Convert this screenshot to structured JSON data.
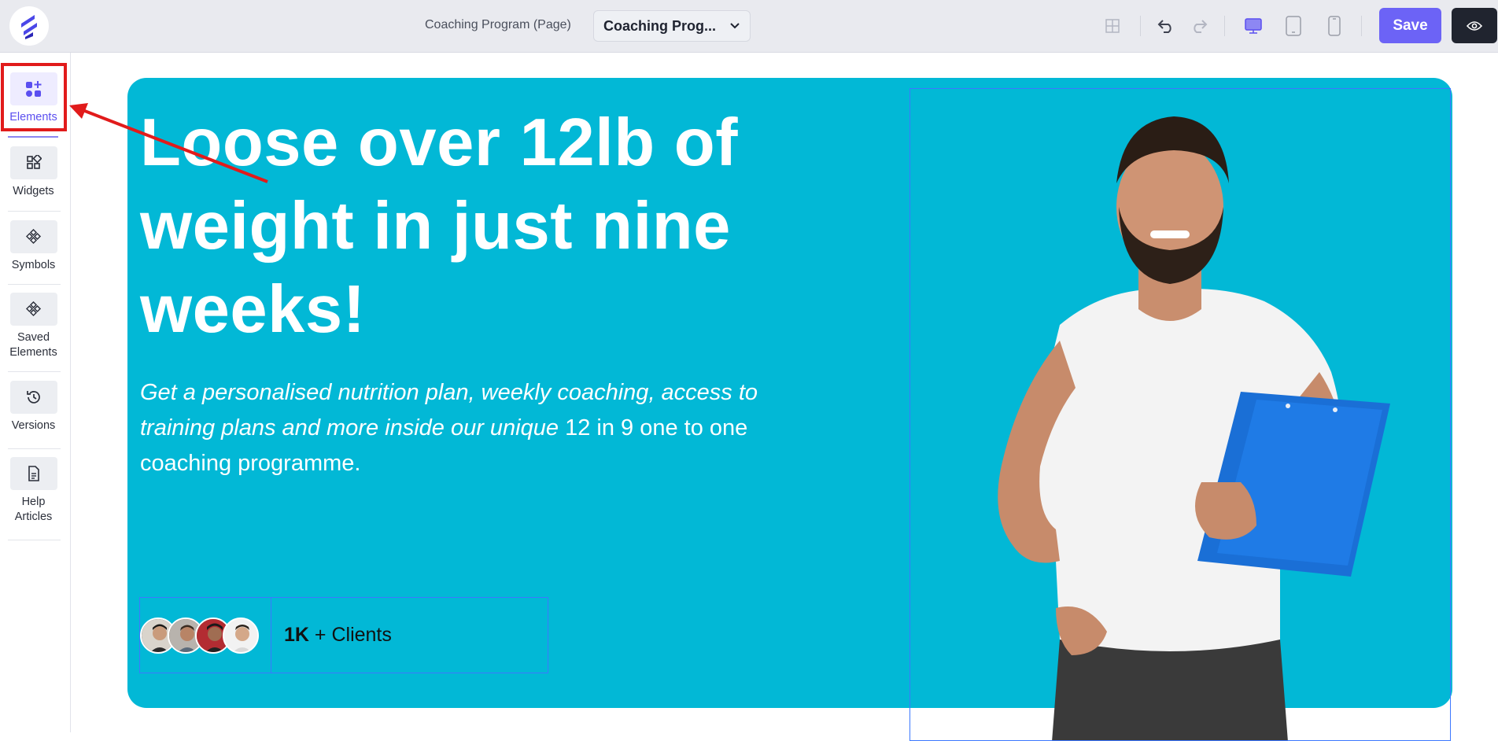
{
  "header": {
    "page_label": "Coaching Program (Page)",
    "page_select_value": "Coaching Prog...",
    "save_label": "Save",
    "icons": [
      "grid-icon",
      "undo-icon",
      "redo-icon",
      "desktop-icon",
      "tablet-icon",
      "mobile-icon",
      "eye-icon"
    ]
  },
  "sidebar": {
    "items": [
      {
        "label": "Elements",
        "icon": "elements-icon",
        "active": true
      },
      {
        "label": "Widgets",
        "icon": "widgets-icon"
      },
      {
        "label": "Symbols",
        "icon": "symbols-icon"
      },
      {
        "label": "Saved Elements",
        "icon": "saved-elements-icon"
      },
      {
        "label": "Versions",
        "icon": "history-icon"
      },
      {
        "label": "Help Articles",
        "icon": "document-icon"
      }
    ]
  },
  "hero": {
    "headline": "Loose over 12lb of weight in just nine weeks!",
    "subtext_italic": "Get a personalised nutrition plan, weekly coaching, access to training plans and more inside our unique",
    "subtext_normal": " 12 in 9 one to one coaching programme.",
    "clients_count": "1K",
    "clients_label": " + Clients",
    "background_color": "#02b8d6"
  },
  "colors": {
    "accent": "#6c63f6",
    "highlight": "#e11b1b",
    "selection": "#3c78ff"
  }
}
